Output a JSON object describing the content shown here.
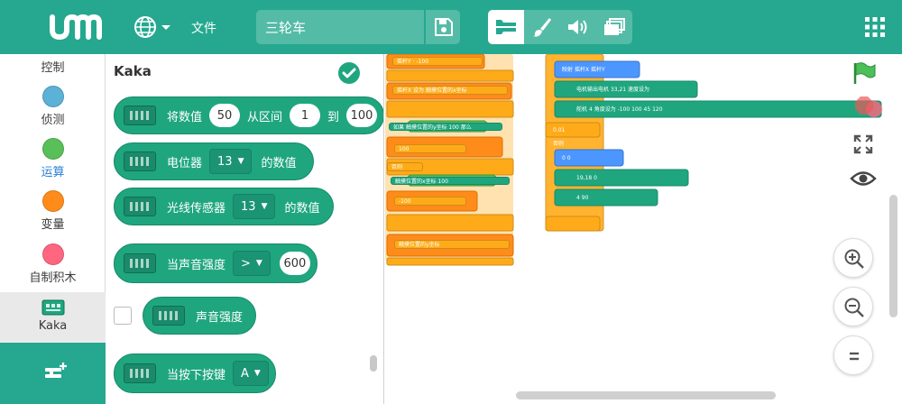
{
  "topbar": {
    "file_menu": "文件",
    "project_title": "三轮车",
    "colors": {
      "bar": "#25a88f",
      "active_mode_icon": "#25a88f"
    },
    "icons": [
      "logo-icon",
      "globe-icon",
      "chevron-down-icon",
      "save-icon",
      "code-blocks-icon",
      "paintbrush-icon",
      "sound-icon",
      "stage-icon",
      "grid-menu-icon"
    ]
  },
  "categories": [
    {
      "label": "控制",
      "color": "#ffab19"
    },
    {
      "label": "侦测",
      "color": "#5cb1d6"
    },
    {
      "label": "运算",
      "color": "#59c059"
    },
    {
      "label": "变量",
      "color": "#ff8c1a"
    },
    {
      "label": "自制积木",
      "color": "#ff6680"
    },
    {
      "label": "Kaka",
      "color": "#1fa67f"
    }
  ],
  "flyout": {
    "title": "Kaka",
    "blocks": {
      "map": {
        "text1": "将数值",
        "value": "50",
        "text2": "从区间",
        "from": "1",
        "text3": "到",
        "to": "100"
      },
      "potentiometer": {
        "text1": "电位器",
        "pin": "13",
        "text2": "的数值"
      },
      "light_sensor": {
        "text1": "光线传感器",
        "pin": "13",
        "text2": "的数值"
      },
      "sound_hat": {
        "text1": "当声音强度",
        "op": ">",
        "value": "600"
      },
      "sound_level": {
        "text1": "声音强度"
      },
      "key_hat": {
        "text1": "当按下按键",
        "key": "A"
      }
    }
  },
  "workspace": {
    "script1": {
      "set1_var": "摇杆Y",
      "set1_val": "-100",
      "set2_var": "摇杆X",
      "set2_text": "设为",
      "set2_val": "触摸位置的x坐标",
      "if_label": "如果",
      "if_cond": "触摸位置的y坐标",
      "if_num": "100",
      "if_then": "那么",
      "set3_val": "100",
      "else_label": "否则",
      "if2_cond": "触摸位置的x坐标",
      "if2_num": "100",
      "set4_val": "-100",
      "set5_val": "触摸位置的y坐标"
    },
    "script2": {
      "map_label": "映射",
      "var_a": "摇杆X",
      "var_b": "摇杆Y",
      "motor1": "电机输出电机",
      "motor1_port": "33,21",
      "motor1_action": "速度设为",
      "servo": "舵机",
      "servo_port": "4",
      "servo_angle": "角度设为",
      "servo_val": "-100",
      "servo_to": "100",
      "servo_map1": "45",
      "servo_map2": "120",
      "wait_val": "0.01",
      "else2": "否则",
      "map2_x": "0",
      "map2_y": "0",
      "motor2_port": "19,18",
      "motor2_val": "0",
      "servo2_port": "4",
      "servo2_val": "90"
    }
  },
  "right_toolbar": {
    "icons": [
      "green-flag-icon",
      "stop-icon",
      "fullscreen-icon",
      "eye-icon",
      "zoom-in-icon",
      "zoom-out-icon",
      "zoom-reset-icon"
    ]
  }
}
